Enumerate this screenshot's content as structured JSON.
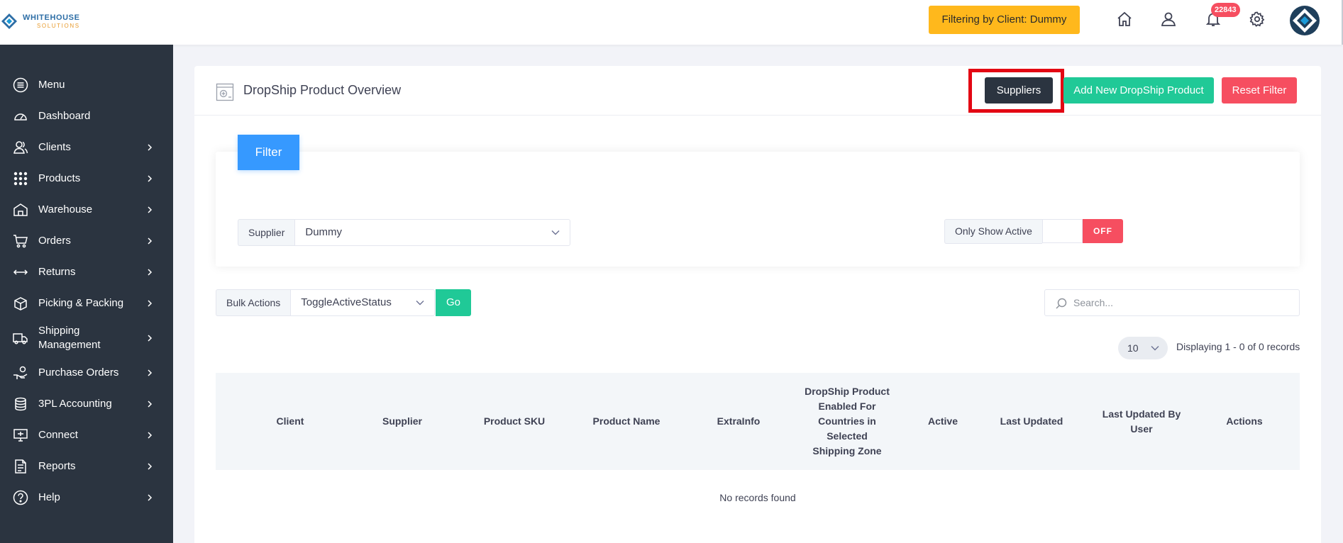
{
  "brand": {
    "name_line1": "WHITEHOUSE",
    "name_line2": "SOLUTIONS"
  },
  "topbar": {
    "client_filter_label": "Filtering by Client: Dummy",
    "notification_count": "22843",
    "icons": [
      "home-icon",
      "user-icon",
      "bell-icon",
      "gear-icon",
      "avatar"
    ]
  },
  "sidebar": {
    "items": [
      {
        "label": "Menu",
        "icon": "menu-icon",
        "has_children": false
      },
      {
        "label": "Dashboard",
        "icon": "dashboard-icon",
        "has_children": false
      },
      {
        "label": "Clients",
        "icon": "clients-icon",
        "has_children": true
      },
      {
        "label": "Products",
        "icon": "grid-icon",
        "has_children": true
      },
      {
        "label": "Warehouse",
        "icon": "warehouse-icon",
        "has_children": true
      },
      {
        "label": "Orders",
        "icon": "cart-icon",
        "has_children": true
      },
      {
        "label": "Returns",
        "icon": "returns-icon",
        "has_children": true
      },
      {
        "label": "Picking & Packing",
        "icon": "box-icon",
        "has_children": true
      },
      {
        "label": "Shipping Management",
        "icon": "truck-icon",
        "has_children": true
      },
      {
        "label": "Purchase Orders",
        "icon": "hand-coin-icon",
        "has_children": true
      },
      {
        "label": "3PL Accounting",
        "icon": "accounting-icon",
        "has_children": true
      },
      {
        "label": "Connect",
        "icon": "monitor-icon",
        "has_children": true
      },
      {
        "label": "Reports",
        "icon": "report-icon",
        "has_children": true
      },
      {
        "label": "Help",
        "icon": "help-icon",
        "has_children": true
      }
    ]
  },
  "page": {
    "title": "DropShip Product Overview",
    "buttons": {
      "suppliers": "Suppliers",
      "add_new": "Add New DropShip Product",
      "reset_filter": "Reset Filter"
    }
  },
  "filter": {
    "tab_label": "Filter",
    "supplier_label": "Supplier",
    "supplier_value": "Dummy",
    "only_show_active_label": "Only Show Active",
    "only_show_active_state": "OFF"
  },
  "bulk": {
    "label": "Bulk Actions",
    "value": "ToggleActiveStatus",
    "go_label": "Go"
  },
  "search": {
    "placeholder": "Search..."
  },
  "pagination": {
    "page_size": "10",
    "display_info": "Displaying 1 - 0 of 0 records"
  },
  "table": {
    "columns": [
      "Client",
      "Supplier",
      "Product SKU",
      "Product Name",
      "ExtraInfo",
      "DropShip Product Enabled For Countries in Selected Shipping Zone",
      "Active",
      "Last Updated",
      "Last Updated By User",
      "Actions"
    ],
    "rows": [],
    "empty_message": "No records found"
  },
  "colors": {
    "sidebar_bg": "#2b3440",
    "filter_chip": "#ffb81c",
    "primary": "#3699ff",
    "success": "#20c997",
    "danger": "#f64e60",
    "highlight": "#e30613"
  }
}
